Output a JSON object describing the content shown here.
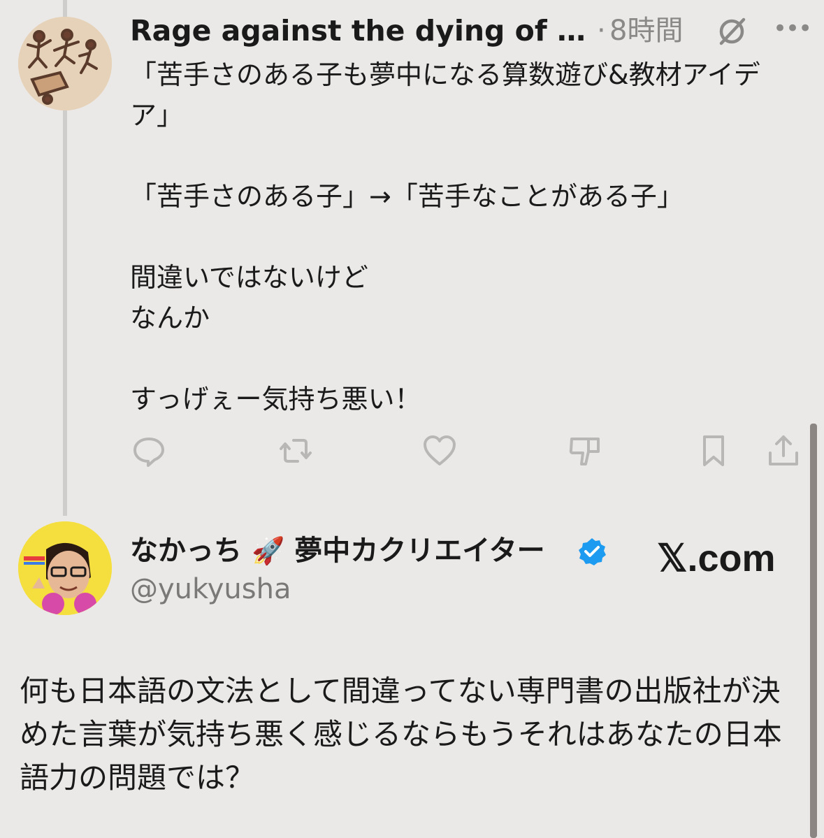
{
  "quoted_post": {
    "author_name": "Rage against the dying of the...",
    "separator": "·",
    "time": "8時間",
    "more_label": "•••",
    "body": "「苦手さのある子も夢中になる算数遊び&教材アイデア」\n\n「苦手さのある子」→「苦手なことがある子」\n\n間違いではないけど\nなんか\n\nすっげぇー気持ち悪い！",
    "actions": [
      "reply-icon",
      "repost-icon",
      "like-icon",
      "dislike-icon",
      "bookmark-icon",
      "share-icon"
    ]
  },
  "reply_post": {
    "author_name": "なかっち",
    "emoji": "🚀",
    "author_title": "夢中カクリエイター",
    "verified": true,
    "handle": "@yukyusha",
    "source": "𝕏.com",
    "body": "何も日本語の文法として間違ってない専門書の出版社が決めた言葉が気持ち悪く感じるならもうそれはあなたの日本語力の問題では？"
  },
  "colors": {
    "background": "#ebe9e7",
    "text": "#1a1a1a",
    "muted": "#8a8988",
    "verified": "#1d9bf0",
    "thread_line": "#cfcdcb"
  }
}
